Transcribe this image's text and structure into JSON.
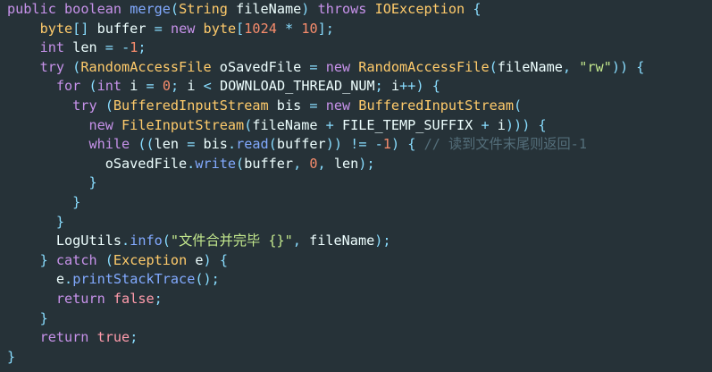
{
  "code": {
    "l1": {
      "a": "public",
      "b": "boolean",
      "c": "merge",
      "d": "(",
      "e": "String",
      "f": "fileName",
      ")": ")",
      "g": "throws",
      "h": "IOException",
      "i": "{"
    },
    "l2": {
      "a": "byte",
      "b": "[]",
      "c": "buffer",
      "d": "=",
      "e": "new",
      "f": "byte",
      "g": "[",
      "h": "1024",
      "i": "*",
      "j": "10",
      "k": "];"
    },
    "l3": {
      "a": "int",
      "b": "len",
      "c": "=",
      "d": "-",
      "e": "1",
      "f": ";"
    },
    "l4": {
      "a": "try",
      "b": "(",
      "c": "RandomAccessFile",
      "d": "oSavedFile",
      "e": "=",
      "f": "new",
      "g": "RandomAccessFile",
      "h": "(",
      "i": "fileName",
      ",": ",",
      "j": "\"rw\"",
      "k": "))",
      "l": "{"
    },
    "l5": {
      "a": "for",
      "b": "(",
      "c": "int",
      "d": "i",
      "e": "=",
      "f": "0",
      "g": ";",
      "h": "i",
      "i": "<",
      "j": "DOWNLOAD_THREAD_NUM",
      "k": ";",
      "l": "i",
      "m": "++",
      "n": ")",
      "o": "{"
    },
    "l6": {
      "a": "try",
      "b": "(",
      "c": "BufferedInputStream",
      "d": "bis",
      "e": "=",
      "f": "new",
      "g": "BufferedInputStream",
      "h": "("
    },
    "l7": {
      "a": "new",
      "b": "FileInputStream",
      "c": "(",
      "d": "fileName",
      "e": "+",
      "f": "FILE_TEMP_SUFFIX",
      "g": "+",
      "h": "i",
      "i": ")))",
      "j": "{"
    },
    "l8": {
      "a": "while",
      "b": "((",
      "c": "len",
      "d": "=",
      "e": "bis",
      "f": ".",
      "g": "read",
      "h": "(",
      "i": "buffer",
      "j": "))",
      "k": "!=",
      "l": "-",
      "m": "1",
      "n": ")",
      "o": "{",
      "p": "// 读到文件末尾则返回-1"
    },
    "l9": {
      "a": "oSavedFile",
      "b": ".",
      "c": "write",
      "d": "(",
      "e": "buffer",
      ",1": ",",
      "f": "0",
      ",2": ",",
      "g": "len",
      "h": ");"
    },
    "l10": {
      "a": "}"
    },
    "l11": {
      "a": "}"
    },
    "l12": {
      "a": "}"
    },
    "l13": {
      "a": "LogUtils",
      "b": ".",
      "c": "info",
      "d": "(",
      "e": "\"文件合并完毕 {}\"",
      "f": ",",
      "g": "fileName",
      "h": ");"
    },
    "l14": {
      "a": "}",
      "b": "catch",
      "c": "(",
      "d": "Exception",
      "e": "e",
      "f": ")",
      "g": "{"
    },
    "l15": {
      "a": "e",
      "b": ".",
      "c": "printStackTrace",
      "d": "();"
    },
    "l16": {
      "a": "return",
      "b": "false",
      "c": ";"
    },
    "l17": {
      "a": "}"
    },
    "l18": {
      "a": "return",
      "b": "true",
      "c": ";"
    },
    "l19": {
      "a": "}"
    }
  },
  "colors": {
    "background": "#263238",
    "keyword": "#c792ea",
    "type": "#ffcb6b",
    "function": "#82aaff",
    "string": "#c3e88d",
    "number": "#f78c6c",
    "operator": "#89ddff",
    "comment": "#546e7a"
  }
}
